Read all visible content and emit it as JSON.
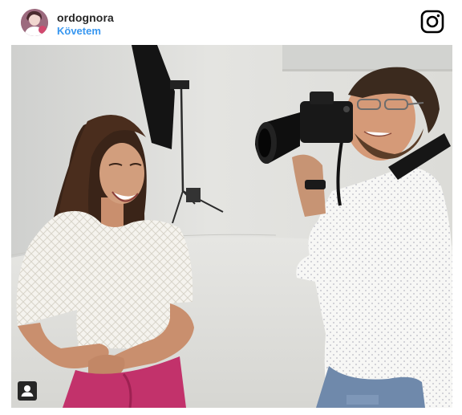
{
  "post": {
    "username": "ordognora",
    "follow_label": "Követem"
  },
  "icons": {
    "avatar": "profile-avatar",
    "brand": "instagram-logo-icon",
    "tagged_people": "user-tag-icon"
  },
  "colors": {
    "follow_link": "#3897f0",
    "username_text": "#262626"
  }
}
